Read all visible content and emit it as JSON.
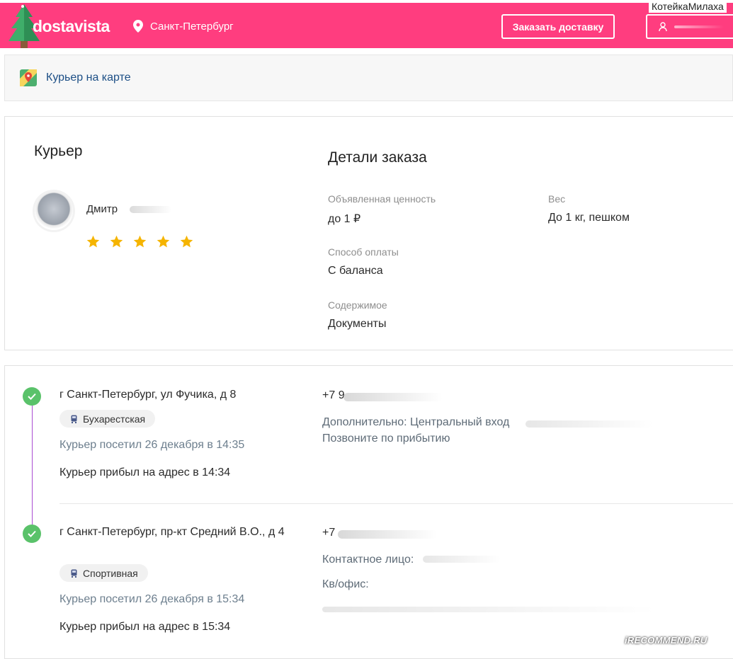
{
  "watermark_user": "КотейкаМилаха",
  "header": {
    "logo": "dostavista",
    "city": "Санкт-Петербург",
    "order_button": "Заказать доставку",
    "user_name": "",
    "brand_color": "#ff3d7f"
  },
  "map": {
    "link": "Курьер на карте",
    "icon": "map-pin-icon"
  },
  "courier": {
    "heading": "Курьер",
    "name": "Дмитр",
    "rating": 5,
    "rating_max": 5
  },
  "order_details": {
    "heading": "Детали заказа",
    "declared_value_label": "Объявленная ценность",
    "declared_value": "до 1 ₽",
    "weight_label": "Вес",
    "weight": "До 1 кг, пешком",
    "payment_label": "Способ оплаты",
    "payment": "С баланса",
    "contents_label": "Содержимое",
    "contents": "Документы"
  },
  "route": [
    {
      "address": "г Санкт-Петербург, ул Фучика, д 8",
      "metro": "Бухарестская",
      "visited": "Курьер посетил 26 декабря в 14:35",
      "arrived": "Курьер прибыл на адрес в 14:34",
      "phone": "+7 9",
      "extra_line1": "Дополнительно: Центральный вход",
      "extra_line2": "Позвоните по прибытию",
      "status": "done"
    },
    {
      "address": "г Санкт-Петербург, пр-кт Средний В.О., д 4",
      "metro": "Спортивная",
      "visited": "Курьер посетил 26 декабря в 15:34",
      "arrived": "Курьер прибыл на адрес в 15:34",
      "phone": "+7",
      "contact_label": "Контактное лицо:",
      "office_label": "Кв/офис:",
      "status": "done"
    }
  ],
  "site_watermark": "iRECOMMEND.RU",
  "colors": {
    "accent": "#ff3d7f",
    "check": "#5ac26a",
    "star": "#f5b400",
    "route_line": "#a94bd1",
    "link": "#1d4f86"
  }
}
